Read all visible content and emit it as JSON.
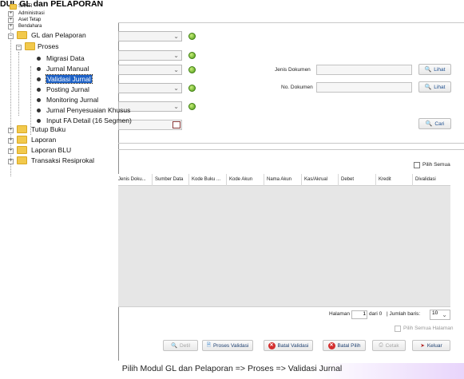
{
  "page_title": "DUL GL dan PELAPORAN",
  "caption": "Pilih Modul GL dan Pelaporan => Proses => Validasi Jurnal",
  "tree": {
    "root": "SAKTI",
    "items_small": [
      "Administrasi",
      "Aset Tetap",
      "Bendahara"
    ],
    "gl": "GL dan Pelaporan",
    "proses": "Proses",
    "proses_children": [
      "Migrasi Data",
      "Jurnal Manual",
      "Validasi Jurnal",
      "Posting Jurnal",
      "Monitoring Jurnal",
      "Jurnal Penyesuaian Khusus",
      "Input FA Detail (16 Segmen)"
    ],
    "selected_index": 2,
    "siblings": [
      "Tutup Buku",
      "Laporan",
      "Laporan BLU",
      "Transaksi Resiprokal"
    ]
  },
  "filters": {
    "jenis_dokumen_label": "Jenis Dokumen",
    "no_dokumen_label": "No. Dokumen",
    "lihat_label": "Lihat",
    "cari_label": "Cari"
  },
  "grid": {
    "pilih_semua": "Pilih Semua",
    "columns": [
      "Jenis Doku...",
      "Sumber Data",
      "Kode Buku ...",
      "Kode Akun",
      "Nama Akun",
      "Kas/Akrual",
      "Debet",
      "Kredit",
      "Divalidasi"
    ]
  },
  "pager": {
    "halaman_label": "Halaman",
    "page_value": "1",
    "dari": "dari 0",
    "jumlah_label": "| Jumlah baris:",
    "rows_value": "10",
    "pilih_semua_halaman": "Pilih Semua Halaman"
  },
  "actions": {
    "detil": "Detil",
    "proses_validasi": "Proses Validasi",
    "batal_validasi": "Batal Validasi",
    "batal_pilih": "Batal Pilih",
    "cetak": "Cetak",
    "keluar": "Keluar"
  }
}
